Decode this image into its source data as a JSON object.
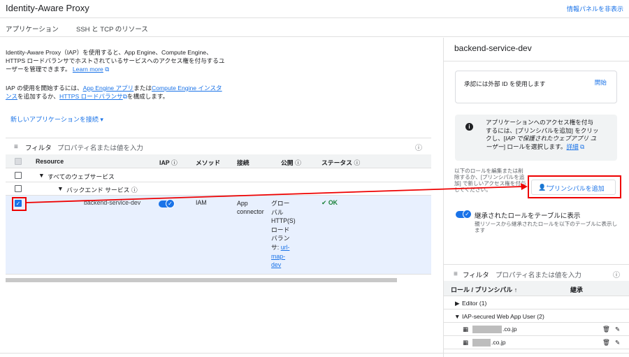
{
  "header": {
    "title": "Identity-Aware Proxy",
    "info_panel_toggle": "情報パネルを非表示"
  },
  "tabs": [
    {
      "label": "アプリケーション"
    },
    {
      "label": "SSH と TCP のリソース"
    }
  ],
  "main": {
    "description_line1": "Identity-Aware Proxy（IAP）を使用すると、App Engine、Compute Engine、",
    "description_line2": "HTTPS ロードバランサでホストされているサービスへのアクセス権を付与するユ",
    "description_line3": "ーザーを管理できます。",
    "learn_more": "Learn more",
    "intro_prefix": "IAP の使用を開始するには、",
    "app_engine_link": "App Engine アプリ",
    "or_text": "または",
    "compute_engine_link_1": "Compute Engine インスタ",
    "compute_engine_link_2": "ンス",
    "add_or_text": "を追加するか、",
    "https_lb_link": "HTTPS ロードバランサ",
    "configure_text": "を構成します。",
    "connect_new_app": "新しいアプリケーションを接続 ▾",
    "filter_label": "フィルタ",
    "filter_placeholder": "プロパティ名または値を入力",
    "columns": {
      "resource": "Resource",
      "iap": "IAP",
      "method": "メソッド",
      "connection": "接続",
      "public": "公開",
      "status": "ステータス"
    },
    "rows": {
      "all_web_services": "すべてのウェブサービス",
      "backend_services": "バックエンド サービス",
      "service_name": "backend-service-dev",
      "method": "IAM",
      "connection_1": "App",
      "connection_2": "connector",
      "public_lines": [
        "グロー",
        "バル",
        "HTTP(S)",
        "ロード",
        "バラン",
        "サ: "
      ],
      "public_link_lines": [
        "url-",
        "map-",
        "dev"
      ],
      "status": "OK"
    }
  },
  "panel": {
    "service_name": "backend-service-dev",
    "external_id_text": "承認には外部 ID を使用します",
    "external_id_action": "開始",
    "info_line1": "アプリケーションへのアクセス権を付与",
    "info_line2": "するには、[プリンシパルを追加] をクリッ",
    "info_line3a": "クし、[",
    "info_line3b": "IAP で保護されたウェブアプリ ユ",
    "info_line4a": "ーザー",
    "info_line4b": "] ロールを選択します。",
    "info_link": "詳細",
    "edit_note": "以下のロールを編集または削除するか、[プリンシパルを追加] で新しいアクセス権を付与してください。",
    "add_principal": "プリンシパルを追加",
    "inherited_label": "継承されたロールをテーブルに表示",
    "inherited_sub": "親リソースから継承されたロールを以下のテーブルに表示します",
    "filter_label": "フィルタ",
    "filter_placeholder": "プロパティ名または値を入力",
    "col_role": "ロール / プリンシパル",
    "col_inherited": "継承",
    "roles": [
      {
        "label": "Editor (1)"
      },
      {
        "label": "IAP-secured Web App User (2)"
      }
    ],
    "principals": [
      {
        "suffix": ".co.jp"
      },
      {
        "suffix": ".co.jp"
      }
    ]
  },
  "colors": {
    "accent": "#1a73e8",
    "highlight_box": "#ee0000",
    "ok": "#188038"
  }
}
